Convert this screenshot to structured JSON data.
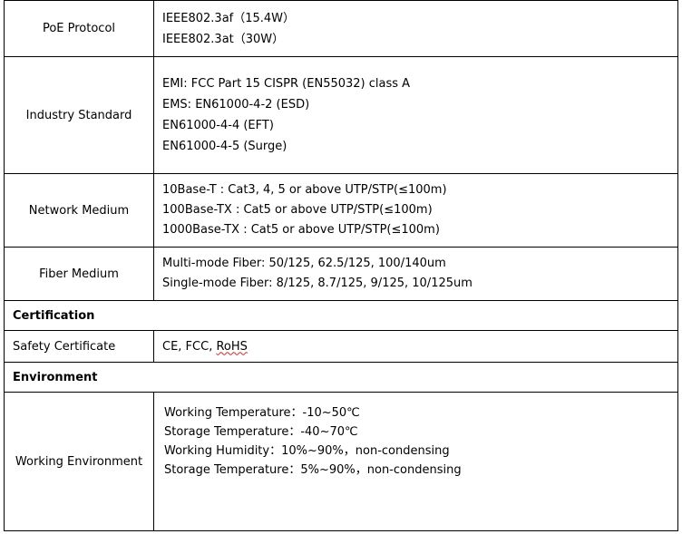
{
  "rows": [
    {
      "label": "PoE Protocol",
      "lines": [
        "IEEE802.3af（15.4W）",
        "IEEE802.3at（30W）"
      ]
    },
    {
      "label": "Industry Standard",
      "lines": [
        "EMI: FCC Part 15 CISPR (EN55032) class A",
        "EMS: EN61000-4-2 (ESD)",
        "EN61000-4-4 (EFT)",
        "EN61000-4-5 (Surge)"
      ]
    },
    {
      "label": "Network Medium",
      "lines": [
        "10Base-T : Cat3, 4, 5 or above UTP/STP(≤100m)",
        "100Base-TX : Cat5 or above UTP/STP(≤100m)",
        "1000Base-TX : Cat5 or above UTP/STP(≤100m)"
      ]
    },
    {
      "label": "Fiber Medium",
      "lines": [
        "Multi-mode Fiber: 50/125, 62.5/125, 100/140um",
        "Single-mode Fiber: 8/125, 8.7/125, 9/125, 10/125um"
      ]
    }
  ],
  "sections": {
    "certification": "Certification",
    "environment": "Environment"
  },
  "certification_row": {
    "label": "Safety Certificate",
    "value_prefix": "CE, FCC, ",
    "value_wavy": "RoHS"
  },
  "environment_row": {
    "label": "Working Environment",
    "lines": [
      "Working Temperature：-10~50℃",
      "Storage Temperature：-40~70℃",
      "Working Humidity：10%~90%，non-condensing",
      "Storage Temperature：5%~90%，non-condensing"
    ]
  }
}
